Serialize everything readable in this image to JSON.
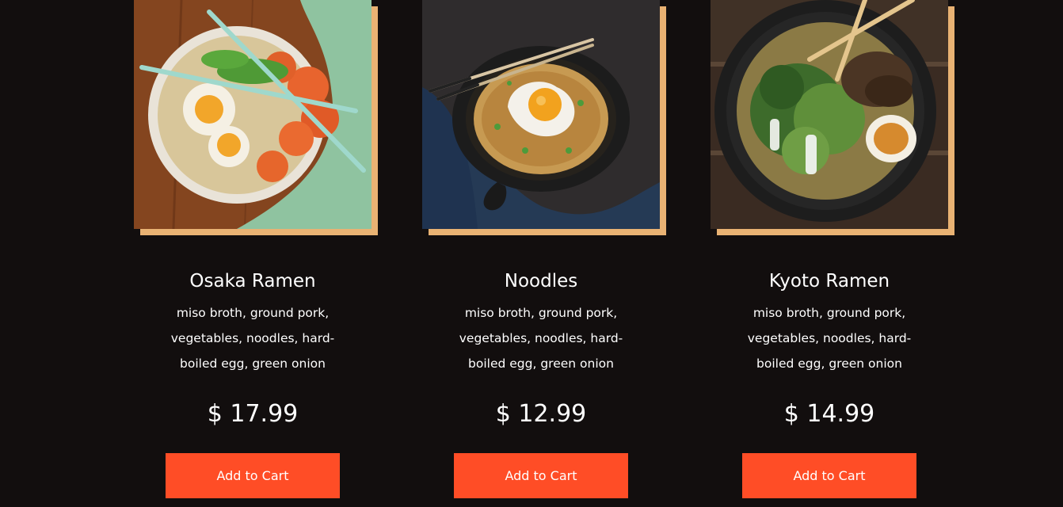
{
  "products": [
    {
      "image_icon": "ramen-with-shrimp-photo",
      "name": "Osaka Ramen",
      "description": "miso broth, ground pork, vegetables, noodles, hard-boiled egg, green onion",
      "price": "$ 17.99",
      "button_label": "Add to Cart"
    },
    {
      "image_icon": "noodles-with-fried-egg-photo",
      "name": "Noodles",
      "description": "miso broth, ground pork, vegetables, noodles, hard-boiled egg, green onion",
      "price": "$ 12.99",
      "button_label": "Add to Cart"
    },
    {
      "image_icon": "ramen-with-sprouts-photo",
      "name": "Kyoto Ramen",
      "description": "miso broth, ground pork, vegetables, noodles, hard-boiled egg, green onion",
      "price": "$ 14.99",
      "button_label": "Add to Cart"
    }
  ],
  "colors": {
    "background": "#120e0e",
    "accent_frame": "#e9b273",
    "button": "#ff4d26",
    "text": "#ffffff"
  }
}
